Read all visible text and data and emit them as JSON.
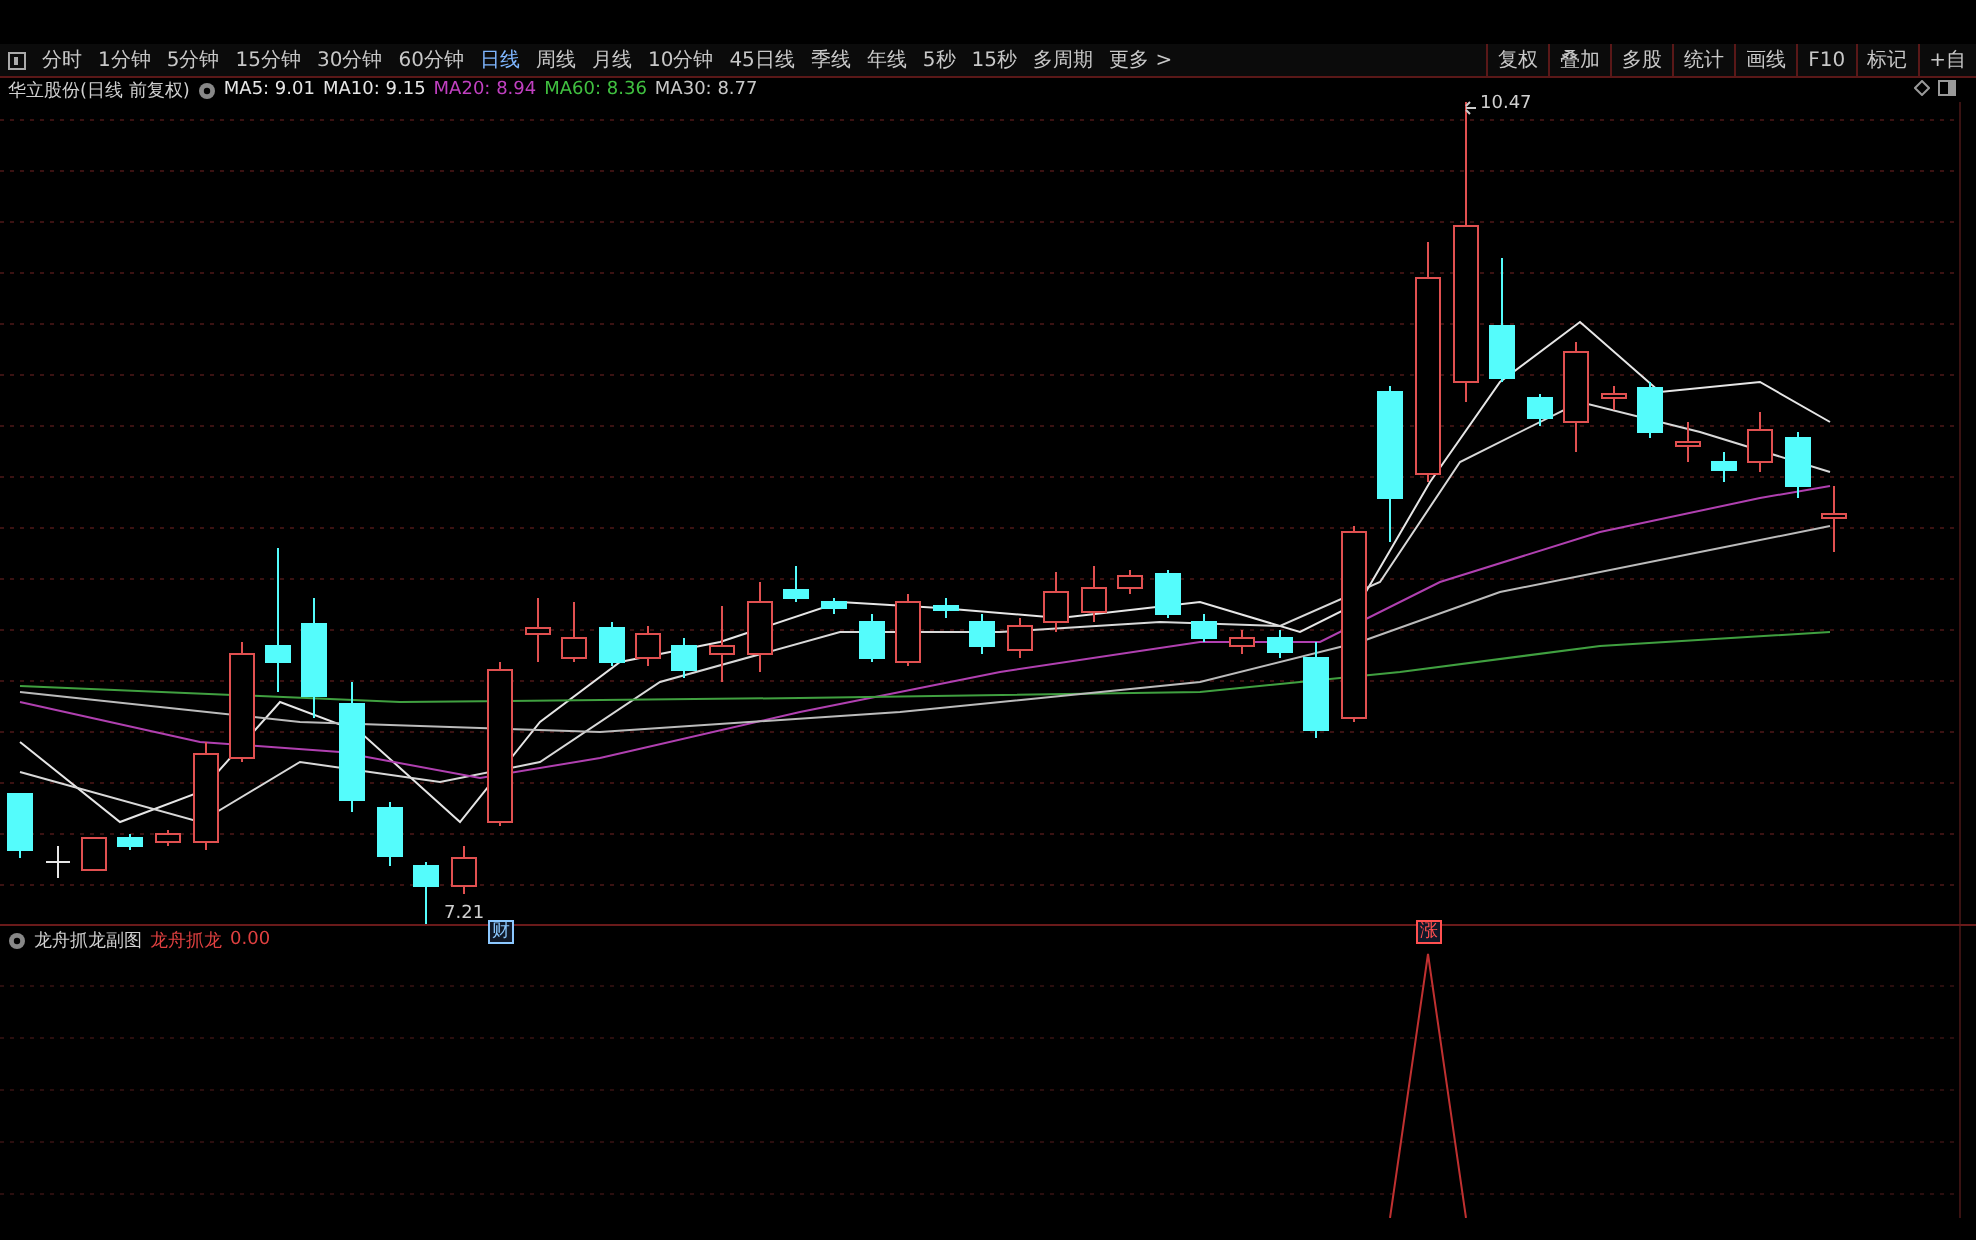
{
  "period_tabs": [
    {
      "label": "分时",
      "selected": false
    },
    {
      "label": "1分钟",
      "selected": false
    },
    {
      "label": "5分钟",
      "selected": false
    },
    {
      "label": "15分钟",
      "selected": false
    },
    {
      "label": "30分钟",
      "selected": false
    },
    {
      "label": "60分钟",
      "selected": false
    },
    {
      "label": "日线",
      "selected": true
    },
    {
      "label": "周线",
      "selected": false
    },
    {
      "label": "月线",
      "selected": false
    },
    {
      "label": "10分钟",
      "selected": false
    },
    {
      "label": "45日线",
      "selected": false
    },
    {
      "label": "季线",
      "selected": false
    },
    {
      "label": "年线",
      "selected": false
    },
    {
      "label": "5秒",
      "selected": false
    },
    {
      "label": "15秒",
      "selected": false
    },
    {
      "label": "多周期",
      "selected": false
    },
    {
      "label": "更多 >",
      "selected": false
    }
  ],
  "toolbar": [
    "复权",
    "叠加",
    "多股",
    "统计",
    "画线",
    "F10",
    "标记",
    "+自"
  ],
  "chart_header": {
    "title": "华立股份(日线 前复权)",
    "indicators": [
      {
        "text": "MA5: 9.01",
        "color": "#e6e6e6"
      },
      {
        "text": "MA10: 9.15",
        "color": "#e6e6e6"
      },
      {
        "text": "MA20: 8.94",
        "color": "#c040c0"
      },
      {
        "text": "MA60: 8.36",
        "color": "#40c040"
      },
      {
        "text": "MA30: 8.77",
        "color": "#c8c8c8"
      }
    ]
  },
  "price_labels": {
    "high": "10.47",
    "low": "7.21"
  },
  "event_markers": [
    {
      "label": "财",
      "color": "#8cc8ff"
    },
    {
      "label": "涨",
      "color": "#ff5050"
    }
  ],
  "sub_panel": {
    "title": "龙舟抓龙副图",
    "line_name": "龙舟抓龙",
    "value": "0.00"
  }
}
